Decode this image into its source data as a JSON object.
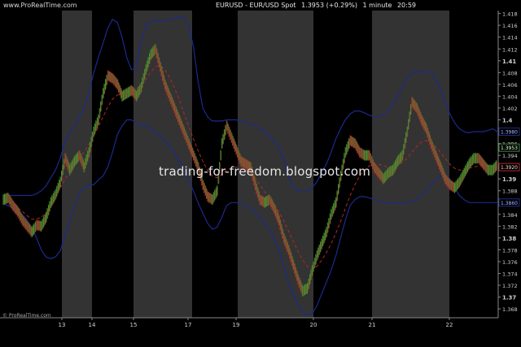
{
  "header": {
    "source_watermark": "www.ProRealTime.com",
    "instrument": "EURUSD - EUR/USD Spot",
    "price": "1.3953 (+0.29%)",
    "timeframe": "1 minute",
    "time": "20:59"
  },
  "footer_watermark": "© ProRealTime.com",
  "overlay_text": "trading-for-freedom.blogspot.com",
  "colors": {
    "background": "#000000",
    "band_shade": "#333333",
    "bollinger": "#1c2a8c",
    "moving_average": "#b02828",
    "candle_up": "#2fa02f",
    "candle_down": "#b43030",
    "price_marker": "#3a8a3a"
  },
  "chart_data": {
    "type": "line",
    "y_axis": {
      "range": [
        1.3665,
        1.4185
      ],
      "ticks": [
        "1.418",
        "1.416",
        "1.414",
        "1.412",
        "1.41",
        "1.408",
        "1.406",
        "1.404",
        "1.402",
        "1.4",
        "1.398",
        "1.396",
        "1.394",
        "1.392",
        "1.39",
        "1.388",
        "1.386",
        "1.384",
        "1.382",
        "1.38",
        "1.378",
        "1.376",
        "1.374",
        "1.372",
        "1.37",
        "1.368"
      ],
      "bold_ticks": [
        "1.41",
        "1.4",
        "1.39",
        "1.38",
        "1.37"
      ]
    },
    "x_axis": {
      "ticks": [
        "13",
        "14",
        "15",
        "17",
        "19",
        "20",
        "21",
        "22"
      ]
    },
    "price_labels": {
      "upper_band": "1.3980",
      "close": "1.3953",
      "moving_average": "1.3920",
      "lower_band": "1.3860"
    },
    "series": [
      {
        "role": "price",
        "values": [
          1.3865,
          1.3868,
          1.3855,
          1.3845,
          1.383,
          1.382,
          1.381,
          1.3822,
          1.382,
          1.3835,
          1.386,
          1.3874,
          1.3895,
          1.3935,
          1.3915,
          1.393,
          1.394,
          1.392,
          1.3945,
          1.398,
          1.4,
          1.4045,
          1.4075,
          1.407,
          1.406,
          1.404,
          1.4045,
          1.405,
          1.404,
          1.4055,
          1.4085,
          1.411,
          1.412,
          1.409,
          1.406,
          1.404,
          1.402,
          1.4,
          1.398,
          1.396,
          1.394,
          1.392,
          1.389,
          1.387,
          1.3865,
          1.388,
          1.396,
          1.399,
          1.397,
          1.395,
          1.393,
          1.3925,
          1.392,
          1.389,
          1.3865,
          1.386,
          1.3865,
          1.385,
          1.383,
          1.38,
          1.378,
          1.3755,
          1.373,
          1.371,
          1.3715,
          1.3745,
          1.377,
          1.379,
          1.381,
          1.384,
          1.386,
          1.3905,
          1.3945,
          1.3965,
          1.396,
          1.3945,
          1.394,
          1.394,
          1.392,
          1.391,
          1.39,
          1.391,
          1.3915,
          1.393,
          1.394,
          1.398,
          1.403,
          1.402,
          1.4,
          1.3985,
          1.396,
          1.394,
          1.392,
          1.39,
          1.389,
          1.3885,
          1.3895,
          1.391,
          1.3925,
          1.3935,
          1.3935,
          1.3925,
          1.3915,
          1.3915,
          1.3925
        ]
      },
      {
        "role": "moving_average",
        "values": [
          1.3865,
          1.3862,
          1.3858,
          1.3852,
          1.3845,
          1.3838,
          1.3832,
          1.3832,
          1.3835,
          1.3842,
          1.3855,
          1.3868,
          1.3885,
          1.39,
          1.391,
          1.3922,
          1.3935,
          1.3945,
          1.3958,
          1.3972,
          1.3988,
          1.4005,
          1.4022,
          1.4035,
          1.4042,
          1.4045,
          1.4047,
          1.405,
          1.4053,
          1.4058,
          1.4068,
          1.408,
          1.409,
          1.4092,
          1.4085,
          1.4072,
          1.4055,
          1.4035,
          1.4012,
          1.399,
          1.3968,
          1.3948,
          1.393,
          1.3915,
          1.3905,
          1.3902,
          1.3908,
          1.3915,
          1.3918,
          1.392,
          1.3918,
          1.3915,
          1.391,
          1.3902,
          1.389,
          1.3878,
          1.3868,
          1.3858,
          1.3845,
          1.383,
          1.3812,
          1.3795,
          1.3778,
          1.3763,
          1.3752,
          1.3748,
          1.3752,
          1.3762,
          1.3775,
          1.379,
          1.3808,
          1.3828,
          1.385,
          1.3872,
          1.389,
          1.3905,
          1.3915,
          1.3922,
          1.3925,
          1.3925,
          1.3922,
          1.392,
          1.392,
          1.3922,
          1.3928,
          1.3935,
          1.3945,
          1.3955,
          1.3962,
          1.3965,
          1.3962,
          1.3955,
          1.3945,
          1.3935,
          1.3925,
          1.3918,
          1.3915,
          1.3915,
          1.3918,
          1.392,
          1.3922,
          1.3923,
          1.3922,
          1.3921,
          1.392
        ]
      },
      {
        "role": "upper_band",
        "values": [
          1.3872,
          1.3872,
          1.3872,
          1.3872,
          1.3872,
          1.3872,
          1.3872,
          1.3875,
          1.388,
          1.3888,
          1.3902,
          1.3915,
          1.3935,
          1.3965,
          1.3978,
          1.399,
          1.4005,
          1.402,
          1.4045,
          1.4078,
          1.4105,
          1.413,
          1.4155,
          1.417,
          1.4165,
          1.414,
          1.4105,
          1.4085,
          1.4088,
          1.4135,
          1.416,
          1.4165,
          1.4168,
          1.4168,
          1.4168,
          1.4168,
          1.4172,
          1.4175,
          1.4172,
          1.416,
          1.4125,
          1.4065,
          1.402,
          1.4005,
          1.3998,
          1.3998,
          1.3998,
          1.4,
          1.4,
          1.4,
          1.3998,
          1.3995,
          1.3993,
          1.399,
          1.3985,
          1.398,
          1.3972,
          1.3965,
          1.3955,
          1.3935,
          1.3905,
          1.3885,
          1.388,
          1.3878,
          1.388,
          1.3885,
          1.3895,
          1.391,
          1.3925,
          1.3945,
          1.3968,
          1.3985,
          1.4,
          1.401,
          1.4015,
          1.4015,
          1.4012,
          1.4008,
          1.4005,
          1.4005,
          1.4008,
          1.4015,
          1.4025,
          1.404,
          1.4055,
          1.407,
          1.408,
          1.4082,
          1.4082,
          1.4082,
          1.408,
          1.407,
          1.405,
          1.403,
          1.401,
          1.3995,
          1.3985,
          1.398,
          1.3978,
          1.398,
          1.398,
          1.398,
          1.3982,
          1.3985,
          1.398
        ]
      },
      {
        "role": "lower_band",
        "values": [
          1.3858,
          1.3855,
          1.385,
          1.3845,
          1.384,
          1.383,
          1.3818,
          1.38,
          1.378,
          1.3768,
          1.3765,
          1.3768,
          1.3778,
          1.3805,
          1.383,
          1.3855,
          1.3875,
          1.3885,
          1.389,
          1.389,
          1.3898,
          1.3905,
          1.392,
          1.3945,
          1.3975,
          1.399,
          1.4,
          1.4,
          1.3995,
          1.399,
          1.399,
          1.3985,
          1.3978,
          1.3972,
          1.3965,
          1.3955,
          1.3945,
          1.393,
          1.3915,
          1.39,
          1.388,
          1.386,
          1.3842,
          1.3825,
          1.3815,
          1.3818,
          1.3835,
          1.3855,
          1.386,
          1.386,
          1.3858,
          1.3855,
          1.385,
          1.3845,
          1.3835,
          1.3825,
          1.3815,
          1.38,
          1.378,
          1.3755,
          1.3725,
          1.3705,
          1.3688,
          1.3675,
          1.367,
          1.3672,
          1.3685,
          1.3705,
          1.3725,
          1.3745,
          1.377,
          1.38,
          1.383,
          1.3855,
          1.3865,
          1.387,
          1.387,
          1.3868,
          1.3865,
          1.3862,
          1.386,
          1.386,
          1.386,
          1.386,
          1.386,
          1.386,
          1.3862,
          1.3865,
          1.3872,
          1.388,
          1.389,
          1.3898,
          1.3905,
          1.3908,
          1.39,
          1.3885,
          1.3872,
          1.3865,
          1.386,
          1.386,
          1.386,
          1.386,
          1.386,
          1.386,
          1.386
        ]
      }
    ],
    "session_shading": [
      [
        0.0,
        0.135
      ],
      [
        0.195,
        0.285
      ],
      [
        0.37,
        0.465
      ],
      [
        0.615,
        0.74
      ],
      [
        0.85,
        1.0
      ]
    ]
  }
}
